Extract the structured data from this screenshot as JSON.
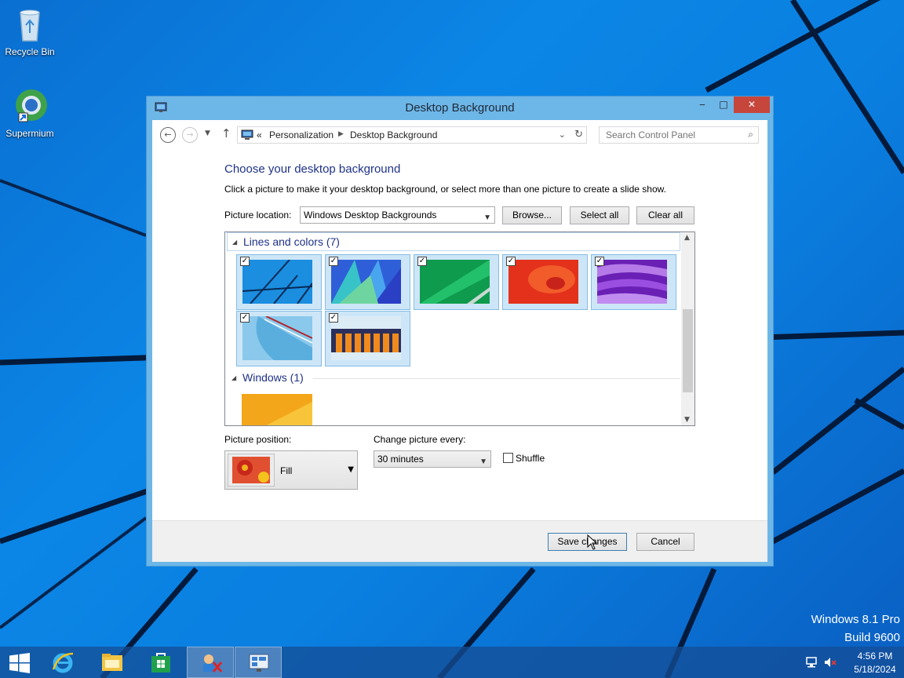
{
  "desktop": {
    "icons": [
      {
        "label": "Recycle Bin",
        "icon": "recycle-bin-icon"
      },
      {
        "label": "Supermium",
        "icon": "supermium-browser-icon"
      }
    ],
    "watermark": {
      "line1": "Windows 8.1 Pro",
      "line2": "Build 9600"
    }
  },
  "window": {
    "title": "Desktop Background",
    "controls": {
      "minimize": "‒",
      "maximize": "□",
      "close": "✕"
    },
    "address": {
      "prefix": "«",
      "crumbs": [
        "Personalization",
        "Desktop Background"
      ]
    },
    "search": {
      "placeholder": "Search Control Panel"
    },
    "heading": "Choose your desktop background",
    "description": "Click a picture to make it your desktop background, or select more than one picture to create a slide show.",
    "picture_location": {
      "label": "Picture location:",
      "value": "Windows Desktop Backgrounds",
      "browse": "Browse...",
      "select_all": "Select all",
      "clear_all": "Clear all"
    },
    "gallery": {
      "groups": [
        {
          "name": "Lines and colors (7)",
          "checked_count": 7
        },
        {
          "name": "Windows (1)"
        }
      ],
      "check_mark": "✓"
    },
    "picture_position": {
      "label": "Picture position:",
      "value": "Fill"
    },
    "change_every": {
      "label": "Change picture every:",
      "value": "30 minutes"
    },
    "shuffle": {
      "label": "Shuffle",
      "checked": false
    },
    "buttons": {
      "save": "Save changes",
      "cancel": "Cancel"
    }
  },
  "taskbar": {
    "items": [
      "start-button",
      "internet-explorer-icon",
      "file-explorer-icon",
      "store-icon",
      "control-panel-icon",
      "desktop-background-task"
    ],
    "clock": {
      "time": "4:56 PM",
      "date": "5/18/2024"
    }
  },
  "colors": {
    "desktop_blue": "#0b86e6",
    "window_border": "#6db6e8",
    "heading_blue": "#1e3287",
    "close_red": "#c7463c"
  }
}
